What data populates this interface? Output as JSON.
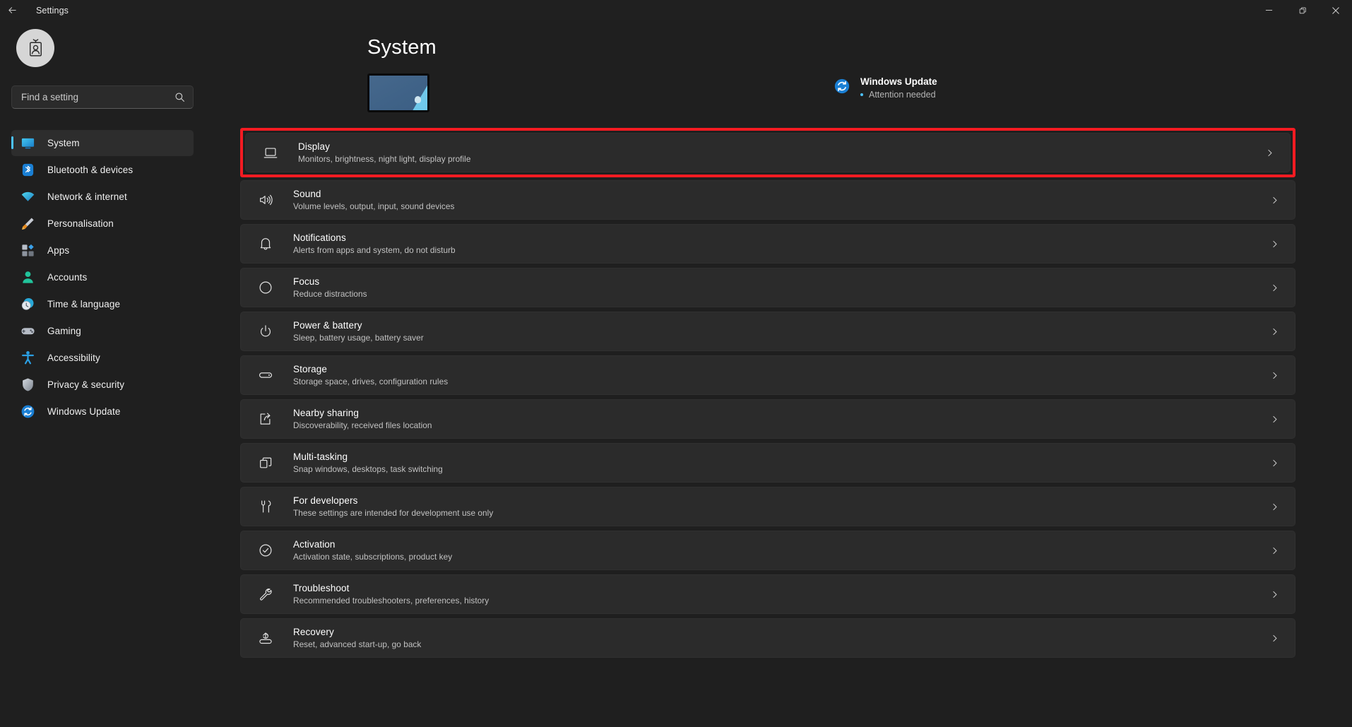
{
  "titlebar": {
    "back_label": "back-arrow",
    "title": "Settings",
    "minimize": "Minimise",
    "restore": "Restore",
    "close": "Close"
  },
  "sidebar": {
    "avatar_icon": "id-badge-icon",
    "search": {
      "placeholder": "Find a setting",
      "value": "",
      "icon": "search-icon"
    },
    "items": [
      {
        "label": "System",
        "icon": "monitor-icon",
        "active": true
      },
      {
        "label": "Bluetooth & devices",
        "icon": "bluetooth-icon",
        "active": false
      },
      {
        "label": "Network & internet",
        "icon": "wifi-icon",
        "active": false
      },
      {
        "label": "Personalisation",
        "icon": "paintbrush-icon",
        "active": false
      },
      {
        "label": "Apps",
        "icon": "apps-grid-icon",
        "active": false
      },
      {
        "label": "Accounts",
        "icon": "person-icon",
        "active": false
      },
      {
        "label": "Time & language",
        "icon": "clock-icon",
        "active": false
      },
      {
        "label": "Gaming",
        "icon": "gamepad-icon",
        "active": false
      },
      {
        "label": "Accessibility",
        "icon": "accessibility-icon",
        "active": false
      },
      {
        "label": "Privacy & security",
        "icon": "shield-icon",
        "active": false
      },
      {
        "label": "Windows Update",
        "icon": "sync-icon",
        "active": false
      }
    ]
  },
  "main": {
    "page_title": "System",
    "device_thumbnail": "desktop-wallpaper-thumbnail",
    "update_status": {
      "icon": "windows-update-icon",
      "title": "Windows Update",
      "status": "Attention needed",
      "accent_color": "#4cc2ff"
    },
    "highlight_color": "#f51b22",
    "rows": [
      {
        "title": "Display",
        "subtitle": "Monitors, brightness, night light, display profile",
        "icon": "monitor-outline-icon",
        "highlighted": true
      },
      {
        "title": "Sound",
        "subtitle": "Volume levels, output, input, sound devices",
        "icon": "speaker-icon",
        "highlighted": false
      },
      {
        "title": "Notifications",
        "subtitle": "Alerts from apps and system, do not disturb",
        "icon": "bell-icon",
        "highlighted": false
      },
      {
        "title": "Focus",
        "subtitle": "Reduce distractions",
        "icon": "focus-moon-icon",
        "highlighted": false
      },
      {
        "title": "Power & battery",
        "subtitle": "Sleep, battery usage, battery saver",
        "icon": "power-icon",
        "highlighted": false
      },
      {
        "title": "Storage",
        "subtitle": "Storage space, drives, configuration rules",
        "icon": "drive-icon",
        "highlighted": false
      },
      {
        "title": "Nearby sharing",
        "subtitle": "Discoverability, received files location",
        "icon": "share-icon",
        "highlighted": false
      },
      {
        "title": "Multi-tasking",
        "subtitle": "Snap windows, desktops, task switching",
        "icon": "windows-stack-icon",
        "highlighted": false
      },
      {
        "title": "For developers",
        "subtitle": "These settings are intended for development use only",
        "icon": "tools-icon",
        "highlighted": false
      },
      {
        "title": "Activation",
        "subtitle": "Activation state, subscriptions, product key",
        "icon": "check-circle-icon",
        "highlighted": false
      },
      {
        "title": "Troubleshoot",
        "subtitle": "Recommended troubleshooters, preferences, history",
        "icon": "wrench-icon",
        "highlighted": false
      },
      {
        "title": "Recovery",
        "subtitle": "Reset, advanced start-up, go back",
        "icon": "recovery-icon",
        "highlighted": false
      }
    ],
    "chevron_icon": "chevron-right-icon"
  }
}
